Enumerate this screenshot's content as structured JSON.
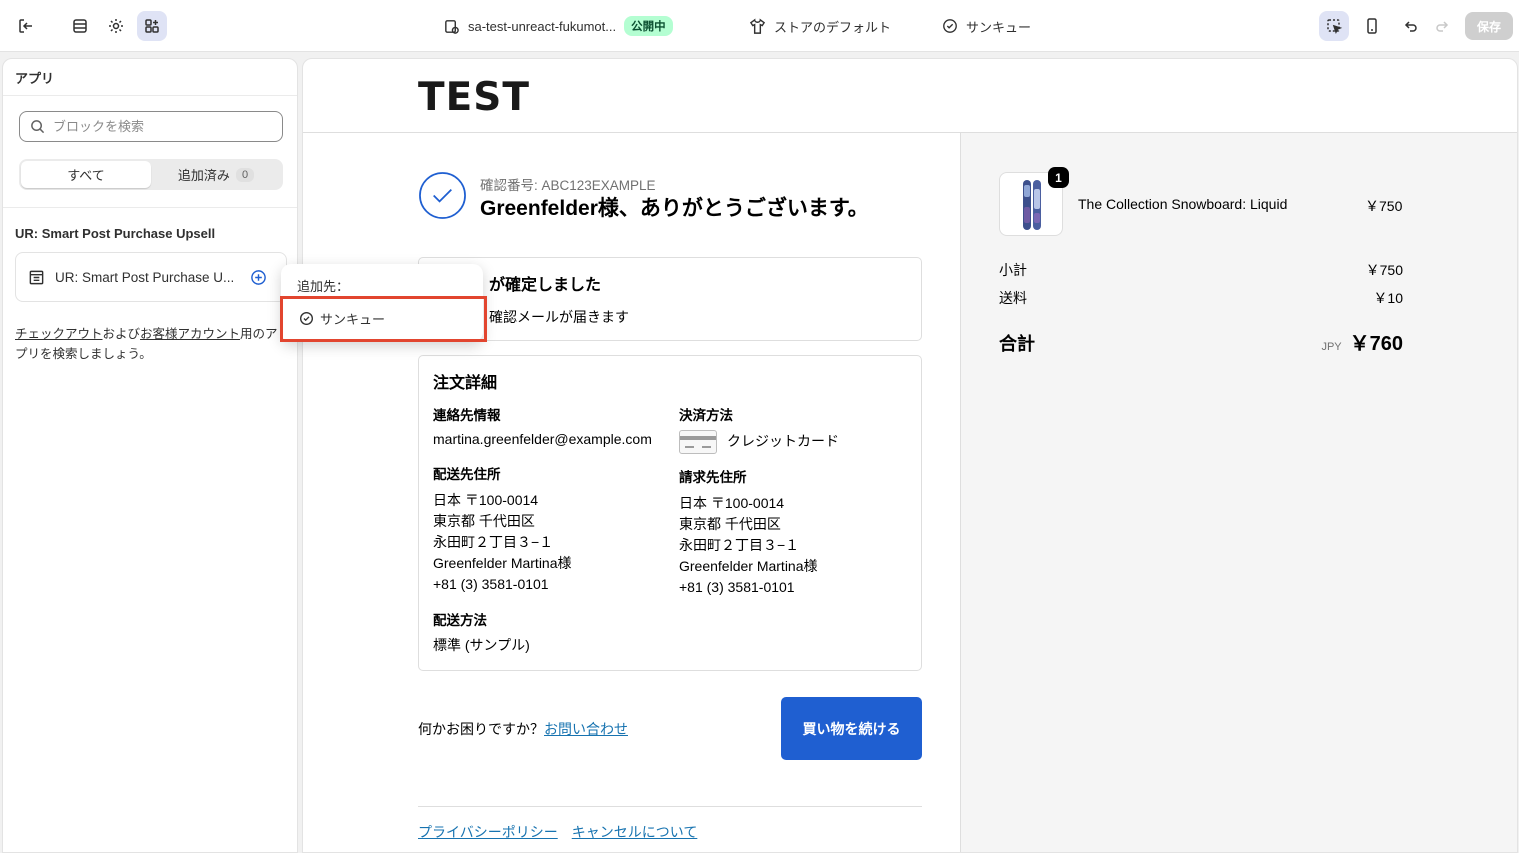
{
  "topbar": {
    "store_name": "sa-test-unreact-fukumot...",
    "status_badge": "公開中",
    "template": "ストアのデフォルト",
    "page": "サンキュー",
    "save_label": "保存"
  },
  "sidebar": {
    "title": "アプリ",
    "search_placeholder": "ブロックを検索",
    "tabs": [
      {
        "label": "すべて"
      },
      {
        "label": "追加済み",
        "count": "0"
      }
    ],
    "section_title": "UR: Smart Post Purchase Upsell",
    "app_block_label": "UR: Smart Post Purchase U...",
    "help": {
      "link1": "チェックアウト",
      "text1": "および",
      "link2": "お客様アカウント",
      "text2": "用のアプリを検索しましょう。"
    }
  },
  "dropdown": {
    "title": "追加先：",
    "item": "サンキュー"
  },
  "preview": {
    "logo": "TEST",
    "confirmation_number": "確認番号: ABC123EXAMPLE",
    "thanks": "Greenfelder様、ありがとうございます。",
    "confirmed_title": "が確定しました",
    "confirmed_sub": "確認メールが届きます",
    "order_details": {
      "title": "注文詳細",
      "contact_label": "連絡先情報",
      "contact_value": "martina.greenfelder@example.com",
      "shipping_address_label": "配送先住所",
      "shipping_address": [
        "日本 〒100-0014",
        "東京都 千代田区",
        "永田町２丁目３−１",
        "Greenfelder Martina様",
        "+81 (3) 3581-0101"
      ],
      "shipping_method_label": "配送方法",
      "shipping_method": "標準 (サンプル)",
      "payment_label": "決済方法",
      "payment_value": "クレジットカード",
      "billing_label": "請求先住所",
      "billing_address": [
        "日本 〒100-0014",
        "東京都 千代田区",
        "永田町２丁目３−１",
        "Greenfelder Martina様",
        "+81 (3) 3581-0101"
      ]
    },
    "help_text": "何かお困りですか？",
    "help_link": "お問い合わせ",
    "continue_button": "買い物を続ける",
    "footer_links": [
      "プライバシーポリシー",
      "キャンセルについて"
    ],
    "summary": {
      "product_name": "The Collection Snowboard: Liquid",
      "product_price": "￥750",
      "quantity": "1",
      "subtotal_label": "小計",
      "subtotal": "￥750",
      "shipping_label": "送料",
      "shipping": "￥10",
      "total_label": "合計",
      "currency": "JPY",
      "total": "￥760"
    }
  },
  "colors": {
    "primary_button": "#1f5fd1",
    "link": "#1773b0",
    "highlight": "#e2452f",
    "published_badge": "#b4fed2"
  }
}
